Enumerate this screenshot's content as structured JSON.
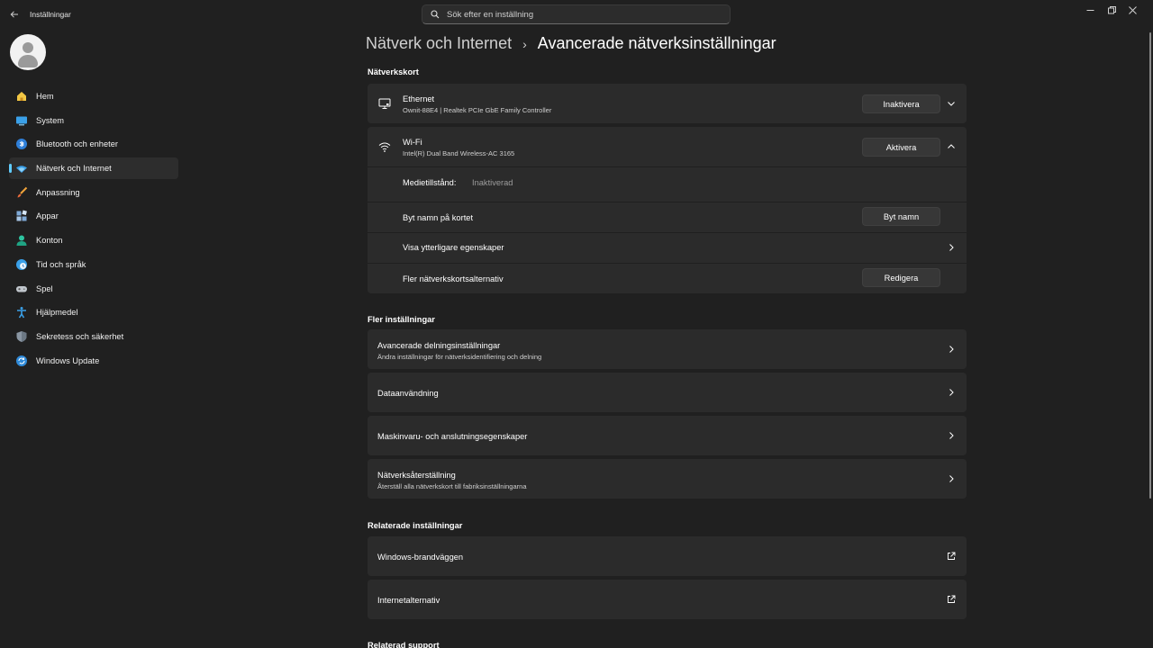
{
  "window": {
    "app_title": "Inställningar",
    "search_placeholder": "Sök efter en inställning"
  },
  "sidebar": {
    "items": [
      {
        "label": "Hem",
        "icon": "home-icon"
      },
      {
        "label": "System",
        "icon": "system-icon"
      },
      {
        "label": "Bluetooth och enheter",
        "icon": "bluetooth-icon"
      },
      {
        "label": "Nätverk och Internet",
        "icon": "network-icon",
        "active": true
      },
      {
        "label": "Anpassning",
        "icon": "brush-icon"
      },
      {
        "label": "Appar",
        "icon": "apps-icon"
      },
      {
        "label": "Konton",
        "icon": "accounts-icon"
      },
      {
        "label": "Tid och språk",
        "icon": "time-language-icon"
      },
      {
        "label": "Spel",
        "icon": "gaming-icon"
      },
      {
        "label": "Hjälpmedel",
        "icon": "accessibility-icon"
      },
      {
        "label": "Sekretess och säkerhet",
        "icon": "shield-icon"
      },
      {
        "label": "Windows Update",
        "icon": "windows-update-icon"
      }
    ]
  },
  "breadcrumb": {
    "parent": "Nätverk och Internet",
    "separator": "›",
    "current": "Avancerade nätverksinställningar"
  },
  "network_adapters": {
    "title": "Nätverkskort",
    "ethernet": {
      "name": "Ethernet",
      "description": "Ownit-88E4 | Realtek PCIe GbE Family Controller",
      "button": "Inaktivera"
    },
    "wifi": {
      "name": "Wi-Fi",
      "description": "Intel(R) Dual Band Wireless-AC 3165",
      "button": "Aktivera",
      "media_state_label": "Medietillstånd:",
      "media_state_value": "Inaktiverad",
      "rename_label": "Byt namn på kortet",
      "rename_button": "Byt namn",
      "properties_label": "Visa ytterligare egenskaper",
      "more_options_label": "Fler nätverkskortsalternativ",
      "edit_button": "Redigera"
    }
  },
  "more_settings": {
    "title": "Fler inställningar",
    "items": [
      {
        "title": "Avancerade delningsinställningar",
        "subtitle": "Ändra inställningar för nätverksidentifiering och delning"
      },
      {
        "title": "Dataanvändning",
        "subtitle": ""
      },
      {
        "title": "Maskinvaru- och anslutningsegenskaper",
        "subtitle": ""
      },
      {
        "title": "Nätverksåterställning",
        "subtitle": "Återställ alla nätverkskort till fabriksinställningarna"
      }
    ]
  },
  "related_settings": {
    "title": "Relaterade inställningar",
    "items": [
      {
        "title": "Windows-brandväggen"
      },
      {
        "title": "Internetalternativ"
      }
    ]
  },
  "related_support": {
    "title": "Relaterad support"
  },
  "colors": {
    "accent": "#60cdff",
    "background": "#202020",
    "card": "#2b2b2b"
  }
}
